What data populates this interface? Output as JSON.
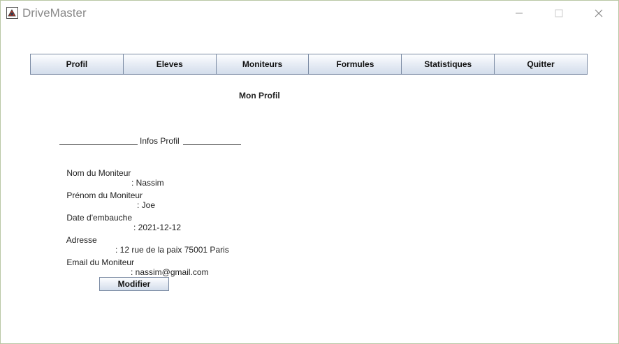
{
  "window": {
    "title": "DriveMaster"
  },
  "nav": {
    "items": [
      {
        "label": "Profil"
      },
      {
        "label": "Eleves"
      },
      {
        "label": "Moniteurs"
      },
      {
        "label": "Formules"
      },
      {
        "label": "Statistiques"
      },
      {
        "label": "Quitter"
      }
    ]
  },
  "page": {
    "title": "Mon Profil",
    "section_label": "Infos Profil"
  },
  "profile": {
    "name_label": "Nom du Moniteur",
    "name_value": ": Nassim",
    "firstname_label": "Prénom du Moniteur",
    "firstname_value": ": Joe",
    "hire_label": "Date d'embauche",
    "hire_value": ": 2021-12-12",
    "address_label": "Adresse",
    "address_value": ": 12 rue de la paix 75001 Paris",
    "email_label": "Email du Moniteur",
    "email_value": ": nassim@gmail.com"
  },
  "actions": {
    "modify_label": "Modifier"
  }
}
